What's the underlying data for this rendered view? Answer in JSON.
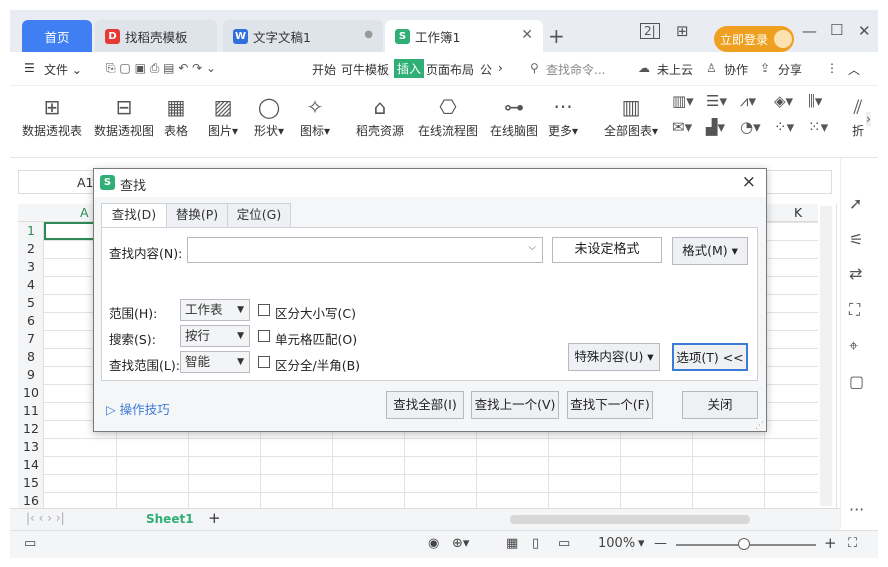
{
  "titlebar": {
    "tabs": [
      {
        "label": "首页"
      },
      {
        "label": "找稻壳模板"
      },
      {
        "label": "文字文稿1"
      },
      {
        "label": "工作簿1"
      }
    ],
    "login_label": "立即登录"
  },
  "menu": {
    "file": "文件",
    "items": [
      "开始",
      "可牛模板",
      "插入",
      "页面布局",
      "公"
    ],
    "search_placeholder": "查找命令...",
    "cloud": "未上云",
    "collab": "协作",
    "share": "分享"
  },
  "ribbon": {
    "buttons": [
      "数据透视表",
      "数据透视图",
      "表格",
      "图片",
      "形状",
      "图标",
      "稻壳资源",
      "在线流程图",
      "在线脑图",
      "更多",
      "全部图表",
      "折"
    ]
  },
  "sheet": {
    "cell_ref": "A1",
    "columns": [
      "A",
      "K"
    ],
    "rows": [
      "1",
      "2",
      "3",
      "4",
      "5",
      "6",
      "7",
      "8",
      "9",
      "10",
      "11",
      "12",
      "13",
      "14",
      "15",
      "16"
    ],
    "sheet_tab": "Sheet1"
  },
  "status": {
    "zoom": "100%"
  },
  "dialog": {
    "title": "查找",
    "close": "×",
    "tabs": [
      "查找(D)",
      "替换(P)",
      "定位(G)"
    ],
    "find_label": "查找内容(N):",
    "find_value": "",
    "format_unset": "未设定格式",
    "format_button": "格式(M)",
    "scope_label": "范围(H):",
    "scope_value": "工作表",
    "search_label": "搜索(S):",
    "search_value": "按行",
    "lookin_label": "查找范围(L):",
    "lookin_value": "智能",
    "opt_case": "区分大小写(C)",
    "opt_cell": "单元格匹配(O)",
    "opt_width": "区分全/半角(B)",
    "special_button": "特殊内容(U)",
    "options_button": "选项(T) <<",
    "tips_link": "操作技巧",
    "find_all": "查找全部(I)",
    "find_prev": "查找上一个(V)",
    "find_next": "查找下一个(F)",
    "close_button": "关闭"
  }
}
